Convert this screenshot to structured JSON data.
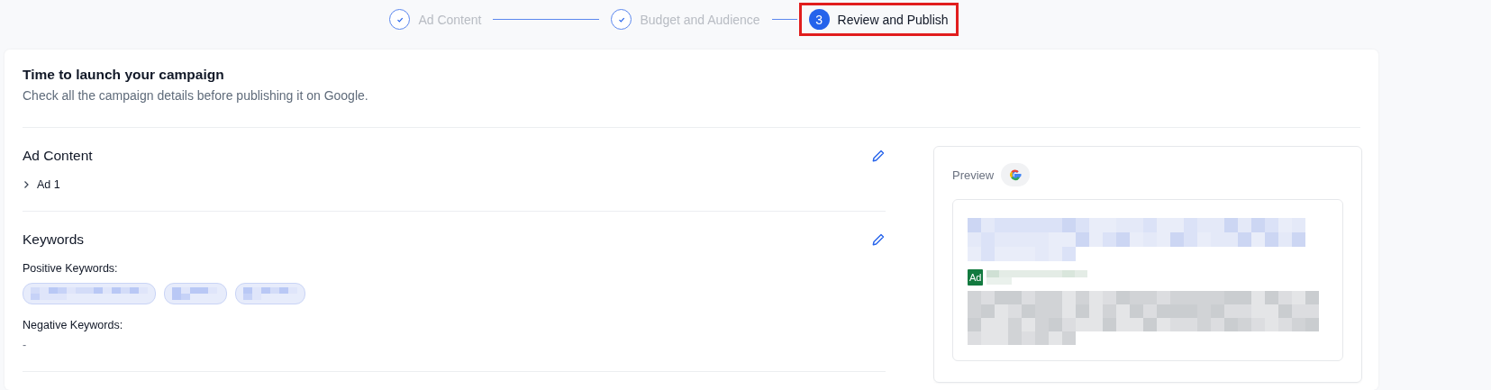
{
  "stepper": {
    "steps": [
      {
        "label": "Ad Content",
        "completed": true,
        "selected": false,
        "highlighted": false
      },
      {
        "label": "Budget and Audience",
        "completed": true,
        "selected": false,
        "highlighted": false
      },
      {
        "number": "3",
        "label": "Review and Publish",
        "completed": false,
        "selected": true,
        "highlighted": true
      }
    ]
  },
  "header": {
    "title": "Time to launch your campaign",
    "subtitle": "Check all the campaign details before publishing it on Google."
  },
  "sections": [
    {
      "kind": "ads",
      "title": "Ad Content",
      "items": [
        {
          "label": "Ad 1",
          "expanded": false
        }
      ]
    },
    {
      "kind": "keywords",
      "title": "Keywords",
      "groups": [
        {
          "label": "Positive Keywords:",
          "chips": [
            {
              "kind": "redacted"
            },
            {
              "kind": "redacted"
            },
            {
              "kind": "redacted"
            }
          ]
        },
        {
          "label": "Negative Keywords:",
          "empty_text": "-"
        }
      ]
    }
  ],
  "preview": {
    "label": "Preview",
    "ad": {
      "badge": "Ad"
    }
  }
}
